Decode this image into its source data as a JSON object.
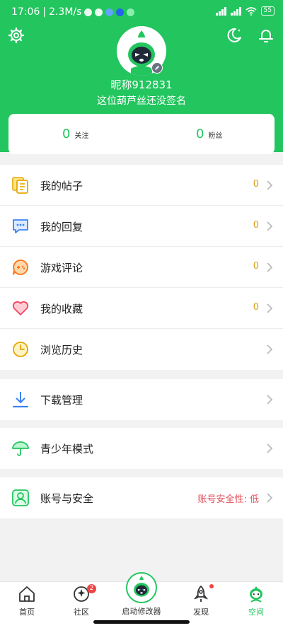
{
  "status_bar": {
    "time": "17:06",
    "network_speed": "2.3M/s",
    "battery": "55"
  },
  "header": {
    "settings_icon": "gear-icon",
    "night_icon": "moon-icon",
    "bell_icon": "bell-icon",
    "nickname": "昵称912831",
    "signature": "这位葫芦丝还没签名",
    "brand_color": "#22c55e"
  },
  "stats": {
    "following_count": "0",
    "following_label": "关注",
    "followers_count": "0",
    "followers_label": "粉丝"
  },
  "menu": {
    "posts": {
      "label": "我的帖子",
      "count": "0",
      "icon": "posts-icon"
    },
    "replies": {
      "label": "我的回复",
      "count": "0",
      "icon": "reply-icon"
    },
    "game_reviews": {
      "label": "游戏评论",
      "count": "0",
      "icon": "gamepad-icon"
    },
    "favorites": {
      "label": "我的收藏",
      "count": "0",
      "icon": "heart-icon"
    },
    "history": {
      "label": "浏览历史",
      "icon": "clock-icon"
    },
    "downloads": {
      "label": "下载管理",
      "icon": "download-icon"
    },
    "teen_mode": {
      "label": "青少年模式",
      "icon": "umbrella-icon"
    },
    "account": {
      "label": "账号与安全",
      "status": "账号安全性: 低",
      "icon": "user-card-icon"
    }
  },
  "bottom_nav": {
    "home": "首页",
    "community": "社区",
    "community_badge": "2",
    "launcher": "启动修改器",
    "discover": "发现",
    "space": "空间"
  }
}
